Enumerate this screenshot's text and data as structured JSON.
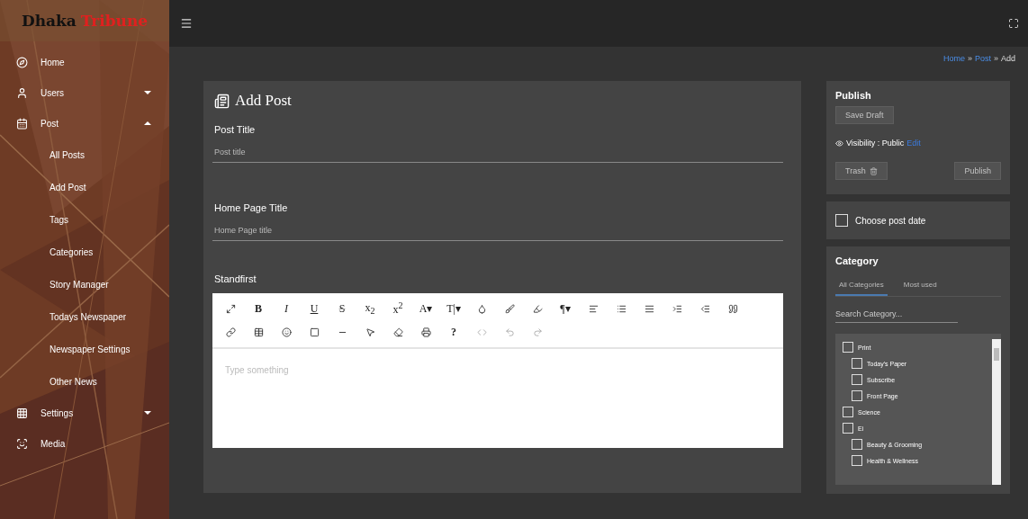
{
  "logo": {
    "first": "Dhaka",
    "second": "Tribune"
  },
  "sidebar": {
    "items": [
      {
        "label": "Home"
      },
      {
        "label": "Users",
        "expanded": false
      },
      {
        "label": "Post",
        "expanded": true,
        "children": [
          {
            "label": "All Posts"
          },
          {
            "label": "Add Post"
          },
          {
            "label": "Tags"
          },
          {
            "label": "Categories"
          },
          {
            "label": "Story Manager"
          },
          {
            "label": "Todays Newspaper"
          },
          {
            "label": "Newspaper Settings"
          },
          {
            "label": "Other News"
          }
        ]
      },
      {
        "label": "Settings",
        "expanded": false
      },
      {
        "label": "Media"
      }
    ]
  },
  "breadcrumb": [
    {
      "label": "Home",
      "link": true
    },
    {
      "label": "Post",
      "link": true
    },
    {
      "label": "Add",
      "link": false
    }
  ],
  "breadcrumb_separator": "»",
  "editor_card": {
    "title": "Add Post",
    "fields": [
      {
        "label": "Post Title",
        "placeholder": "Post title"
      },
      {
        "label": "Home Page Title",
        "placeholder": "Home Page title"
      }
    ],
    "standfirst": {
      "label": "Standfirst",
      "placeholder": "Type something",
      "toolbar": [
        [
          {
            "kind": "expand"
          },
          {
            "kind": "bold",
            "text": "B"
          },
          {
            "kind": "italic",
            "text": "I"
          },
          {
            "kind": "underline",
            "text": "U"
          },
          {
            "kind": "strike",
            "text": "S"
          },
          {
            "kind": "text",
            "text": "x$_{2}$"
          },
          {
            "kind": "text",
            "text": "x$^{2}$"
          },
          {
            "kind": "text",
            "text": "A▾"
          },
          {
            "kind": "text",
            "text": "T|▾"
          },
          {
            "kind": "drop"
          },
          {
            "kind": "brush"
          },
          {
            "kind": "highlighter"
          },
          {
            "kind": "text",
            "text": "¶▾"
          },
          {
            "kind": "align"
          },
          {
            "kind": "list"
          },
          {
            "kind": "lines"
          },
          {
            "kind": "indent"
          },
          {
            "kind": "outdent"
          },
          {
            "kind": "quote"
          }
        ],
        [
          {
            "kind": "link"
          },
          {
            "kind": "table"
          },
          {
            "kind": "emoji"
          },
          {
            "kind": "square"
          },
          {
            "kind": "rule"
          },
          {
            "kind": "pointer"
          },
          {
            "kind": "eraser"
          },
          {
            "kind": "print"
          },
          {
            "kind": "bold",
            "text": "?"
          },
          {
            "kind": "code"
          },
          {
            "kind": "undo"
          },
          {
            "kind": "redo"
          }
        ]
      ]
    }
  },
  "publish": {
    "title": "Publish",
    "save_draft": {
      "label": "Save Draft",
      "disabled": true
    },
    "visibility": "Visibility : Public",
    "edit": "Edit",
    "trash": {
      "label": "Trash",
      "disabled": true
    },
    "publish_button": {
      "label": "Publish",
      "disabled": true
    }
  },
  "post_date": {
    "label": "Choose post date",
    "checked": false
  },
  "category": {
    "title": "Category",
    "tabs": [
      {
        "label": "All Categories",
        "selected": true
      },
      {
        "label": "Most used",
        "selected": false
      }
    ],
    "search": {
      "placeholder": "Search Category..."
    },
    "tree": [
      {
        "label": "Print",
        "checked": false,
        "children": [
          {
            "label": "Today's Paper",
            "checked": false
          },
          {
            "label": "Subscribe",
            "checked": false
          },
          {
            "label": "Front Page",
            "checked": false
          }
        ]
      },
      {
        "label": "Science",
        "checked": false
      },
      {
        "label": "Ei",
        "checked": false,
        "children": [
          {
            "label": "Beauty & Grooming",
            "checked": false
          },
          {
            "label": "Health & Wellness",
            "checked": false
          }
        ]
      }
    ]
  }
}
